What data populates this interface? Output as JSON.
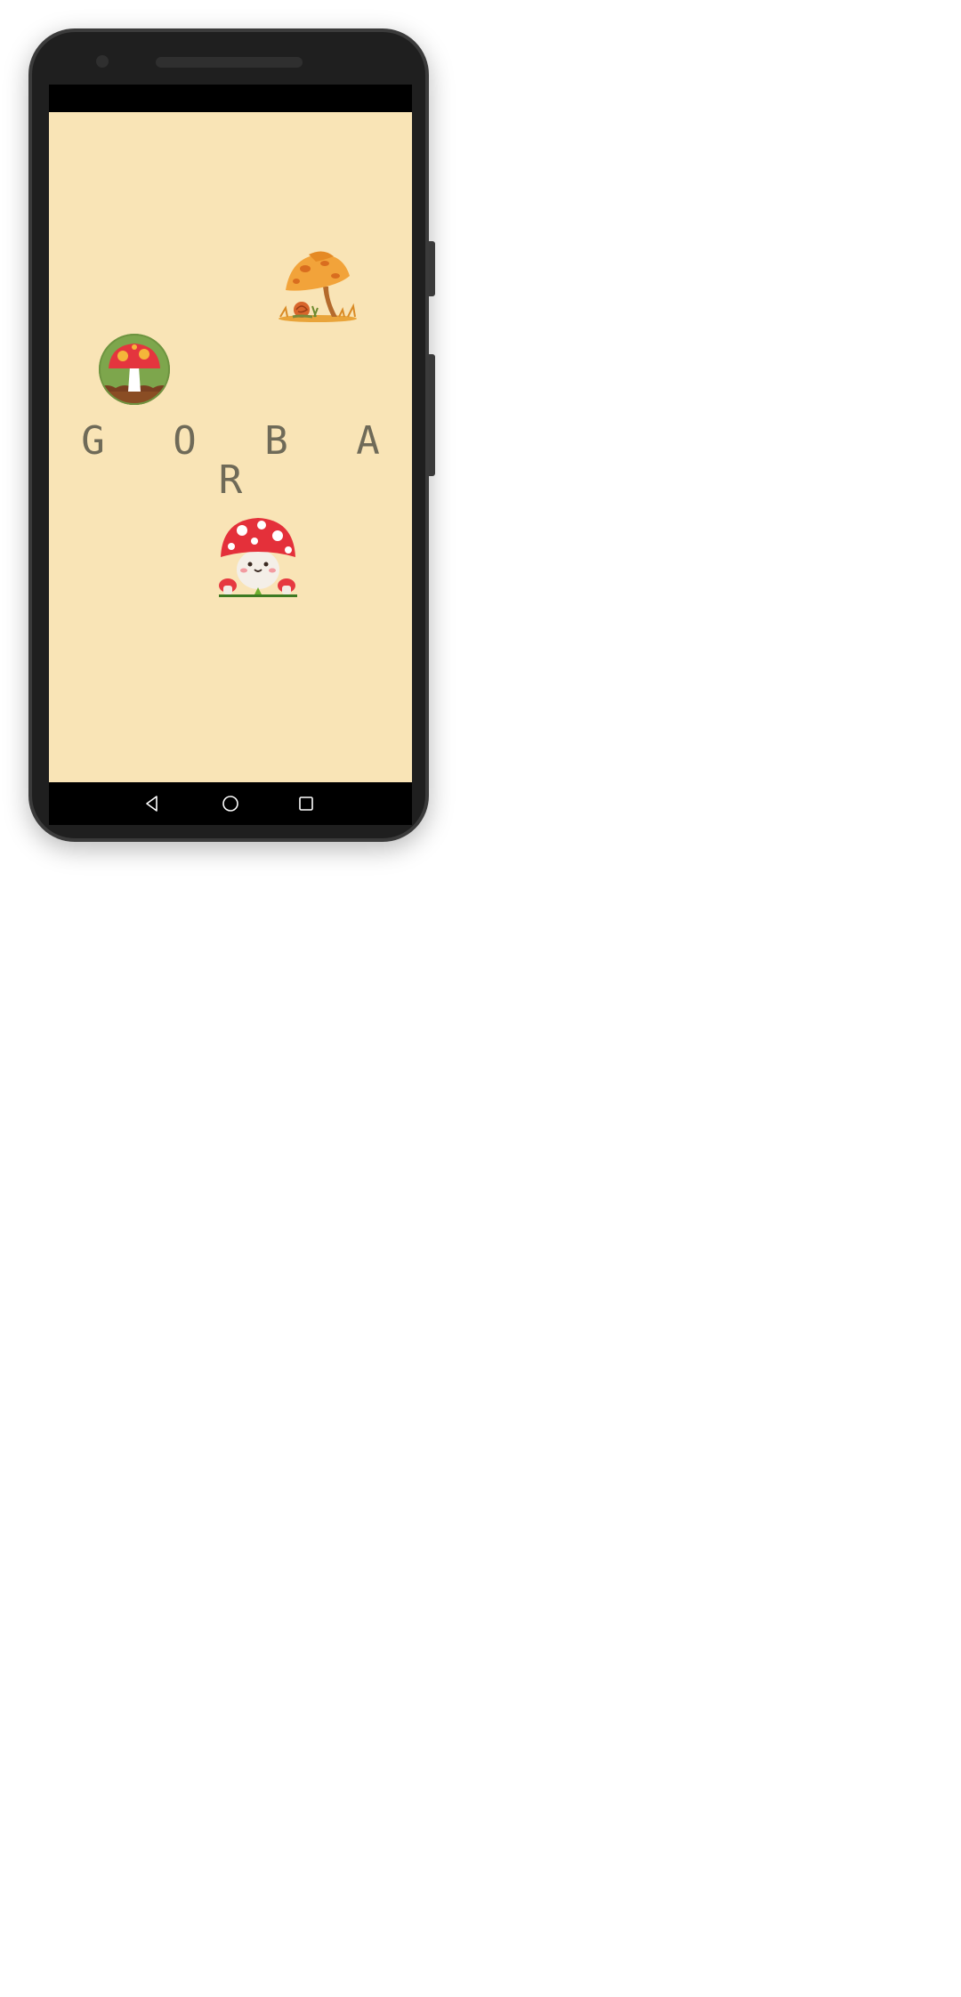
{
  "app": {
    "title": "GOBAR",
    "display_title": "G O B A R"
  },
  "illustrations": [
    {
      "name": "autumn-mushroom-with-snail"
    },
    {
      "name": "red-mushroom-badge"
    },
    {
      "name": "cute-red-mushroom-character"
    }
  ],
  "navigation": {
    "back_icon": "triangle-back-icon",
    "home_icon": "circle-home-icon",
    "recents_icon": "square-recents-icon"
  },
  "colors": {
    "screen_background": "#f9e4b6",
    "title_color": "#6f6a58",
    "system_bars": "#000000",
    "phone_frame": "#1f1f1f"
  }
}
